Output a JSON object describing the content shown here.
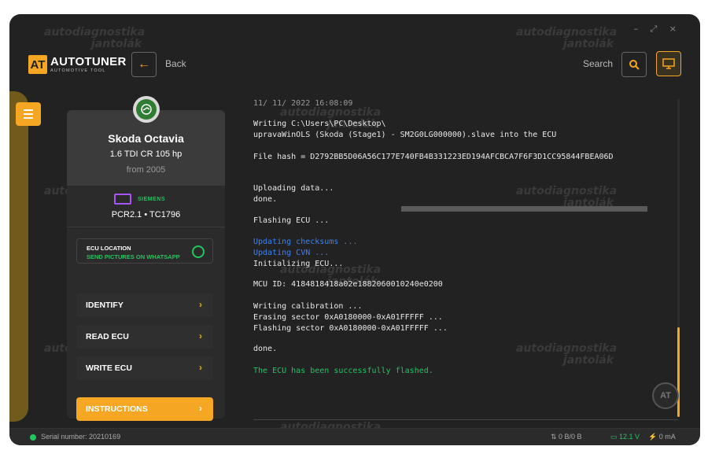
{
  "window": {
    "controls": "– ⤢ ×"
  },
  "header": {
    "logo_name": "AUTOTUNER",
    "logo_sub": "AUTOMOTIVE TOOL",
    "logo_mark": "AT",
    "back_label": "Back",
    "search_label": "Search"
  },
  "vehicle": {
    "model": "Skoda Octavia",
    "engine": "1.6 TDI CR 105 hp",
    "year": "from 2005",
    "ecu_brand": "SIEMENS",
    "ecu_model": "PCR2.1 • TC1796"
  },
  "ecu_location": {
    "title": "ECU LOCATION",
    "subtitle": "SEND PICTURES ON WHATSAPP"
  },
  "actions": [
    {
      "label": "IDENTIFY"
    },
    {
      "label": "READ ECU"
    },
    {
      "label": "WRITE ECU"
    },
    {
      "label": "INSTRUCTIONS"
    }
  ],
  "console": {
    "lines": [
      "11/ 11/ 2022 16:08:09",
      "Writing C:\\Users\\PC\\Desktop\\",
      "upravaWinOLS (Skoda (Stage1) - SM2G0LG000000).slave into the ECU",
      "File hash = D2792BB5D06A56C177E740FB4B331223ED194AFCBCA7F6F3D1CC95844FBEA06D",
      "Uploading data...",
      "done.",
      "Flashing ECU ...",
      "Updating checksums ...",
      "Updating CVN ...",
      "Initializing ECU...",
      "MCU ID: 4184818418a02e1882060010240e0200",
      "Writing calibration ...",
      "Erasing sector 0xA0180000-0xA01FFFFF ...",
      "Flashing sector 0xA0180000-0xA01FFFFF ...",
      "done.",
      "The ECU has been successfully flashed."
    ]
  },
  "status": {
    "serial": "Serial number: 20210169",
    "traffic": "⇅ 0 B/0 B",
    "voltage": "12.1 V",
    "current": "0 mA"
  },
  "watermark": {
    "line1": "autodiagnostika",
    "line2": "jantolák"
  },
  "colors": {
    "accent": "#f5a623",
    "success": "#22c55e",
    "info": "#3b82f6",
    "background": "#222222"
  }
}
